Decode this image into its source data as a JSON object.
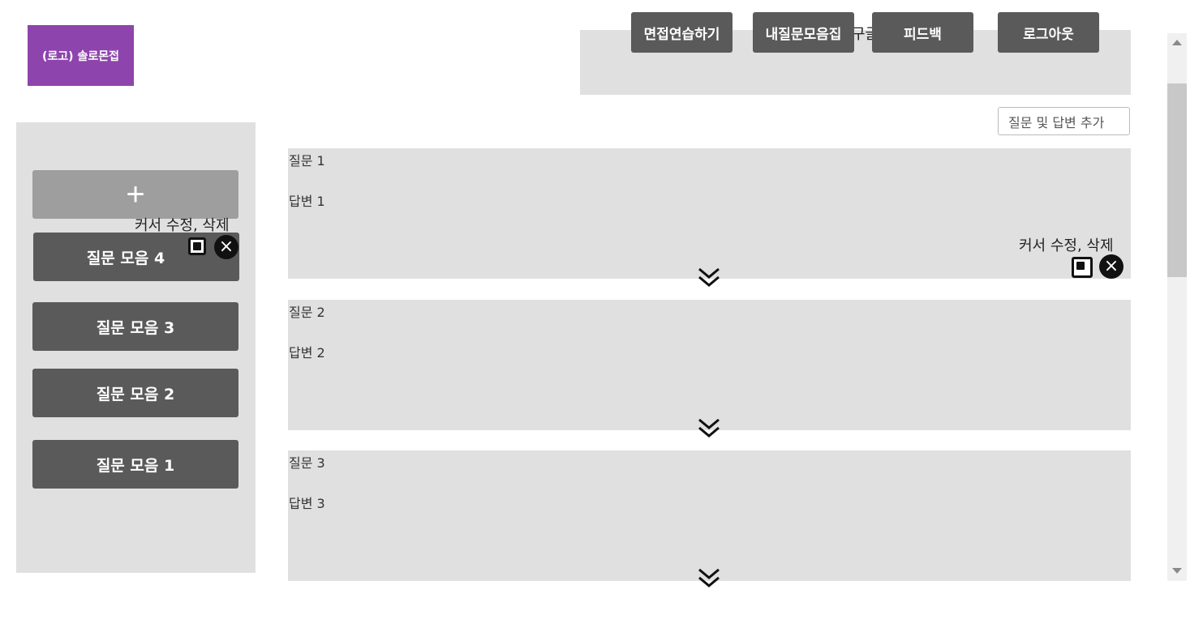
{
  "logo": {
    "text": "(로고) 솔로몬접"
  },
  "nav": {
    "google_link": "구글 설문 링크 연결",
    "buttons": [
      "면접연습하기",
      "내질문모음집",
      "피드백",
      "로그아웃"
    ]
  },
  "main": {
    "add_qa_button": "질문 및 답변 추가",
    "cursor_note": "커서 수정, 삭제",
    "cards": [
      {
        "question": "질문 1",
        "answer": "답변 1"
      },
      {
        "question": "질문 2",
        "answer": "답변 2"
      },
      {
        "question": "질문 3",
        "answer": "답변 3"
      }
    ]
  },
  "sidebar": {
    "add_symbol": "+",
    "cursor_note": "커서 수정, 삭제",
    "sets": [
      "질문 모음 4",
      "질문 모음 3",
      "질문 모음 2",
      "질문 모음 1"
    ]
  },
  "icons": {
    "edit": "square-edit-icon",
    "delete": "circle-x-icon",
    "expand": "double-chevron-down-icon"
  },
  "colors": {
    "logo_bg": "#8e44ad",
    "button_bg": "#5a5a5a",
    "panel_bg": "#e0e0e0",
    "add_button_bg": "#9e9e9e"
  }
}
